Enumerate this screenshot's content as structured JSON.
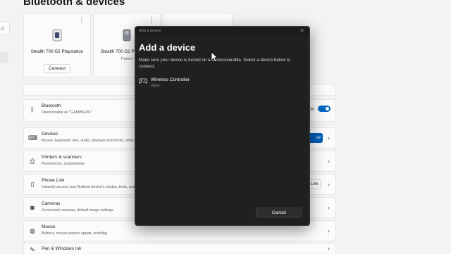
{
  "page": {
    "title": "Bluetooth & devices"
  },
  "search_icon": "⌕",
  "cards": [
    {
      "name": "Stealth 700 G2 Playstation",
      "status": "",
      "action": "Connect",
      "more": "⋮",
      "icon": "headset-icon"
    },
    {
      "name": "Stealth 700 G2 Playstation",
      "status": "Paired",
      "action": "",
      "more": "⋮",
      "icon": "headset-icon"
    }
  ],
  "rows": {
    "bluetooth": {
      "title": "Bluetooth",
      "sub": "Discoverable as \"GAMINGPC\"",
      "toggle_label": "On",
      "toggle_state": "on",
      "icon": "bluetooth-icon"
    },
    "devices": {
      "title": "Devices",
      "sub": "Mouse, keyboard, pen, audio, displays and docks, other",
      "button": "ce",
      "icon": "keyboard-icon"
    },
    "printers": {
      "title": "Printers & scanners",
      "sub": "Preferences, troubleshoot",
      "icon": "printer-icon"
    },
    "phone": {
      "title": "Phone Link",
      "sub": "Instantly access your Android device's photos, texts, and",
      "button": "Link",
      "icon": "phone-icon"
    },
    "cameras": {
      "title": "Cameras",
      "sub": "Connected cameras, default image settings",
      "icon": "camera-icon"
    },
    "mouse": {
      "title": "Mouse",
      "sub": "Buttons, mouse pointer speed, scrolling",
      "icon": "mouse-icon"
    },
    "pen": {
      "title": "Pen & Windows Ink",
      "sub": "",
      "icon": "pen-icon"
    }
  },
  "chevron": "›",
  "dialog": {
    "window_title": "Add a device",
    "close": "✕",
    "heading": "Add a device",
    "description": "Make sure your device is turned on and discoverable. Select a device below to connect.",
    "devices": [
      {
        "name": "Wireless Controller",
        "type": "Input",
        "icon": "gamepad-icon"
      }
    ],
    "cancel_label": "Cancel"
  },
  "colors": {
    "accent": "#0067c0",
    "dialog_bg": "#202020",
    "page_bg": "#f3f3f3"
  }
}
